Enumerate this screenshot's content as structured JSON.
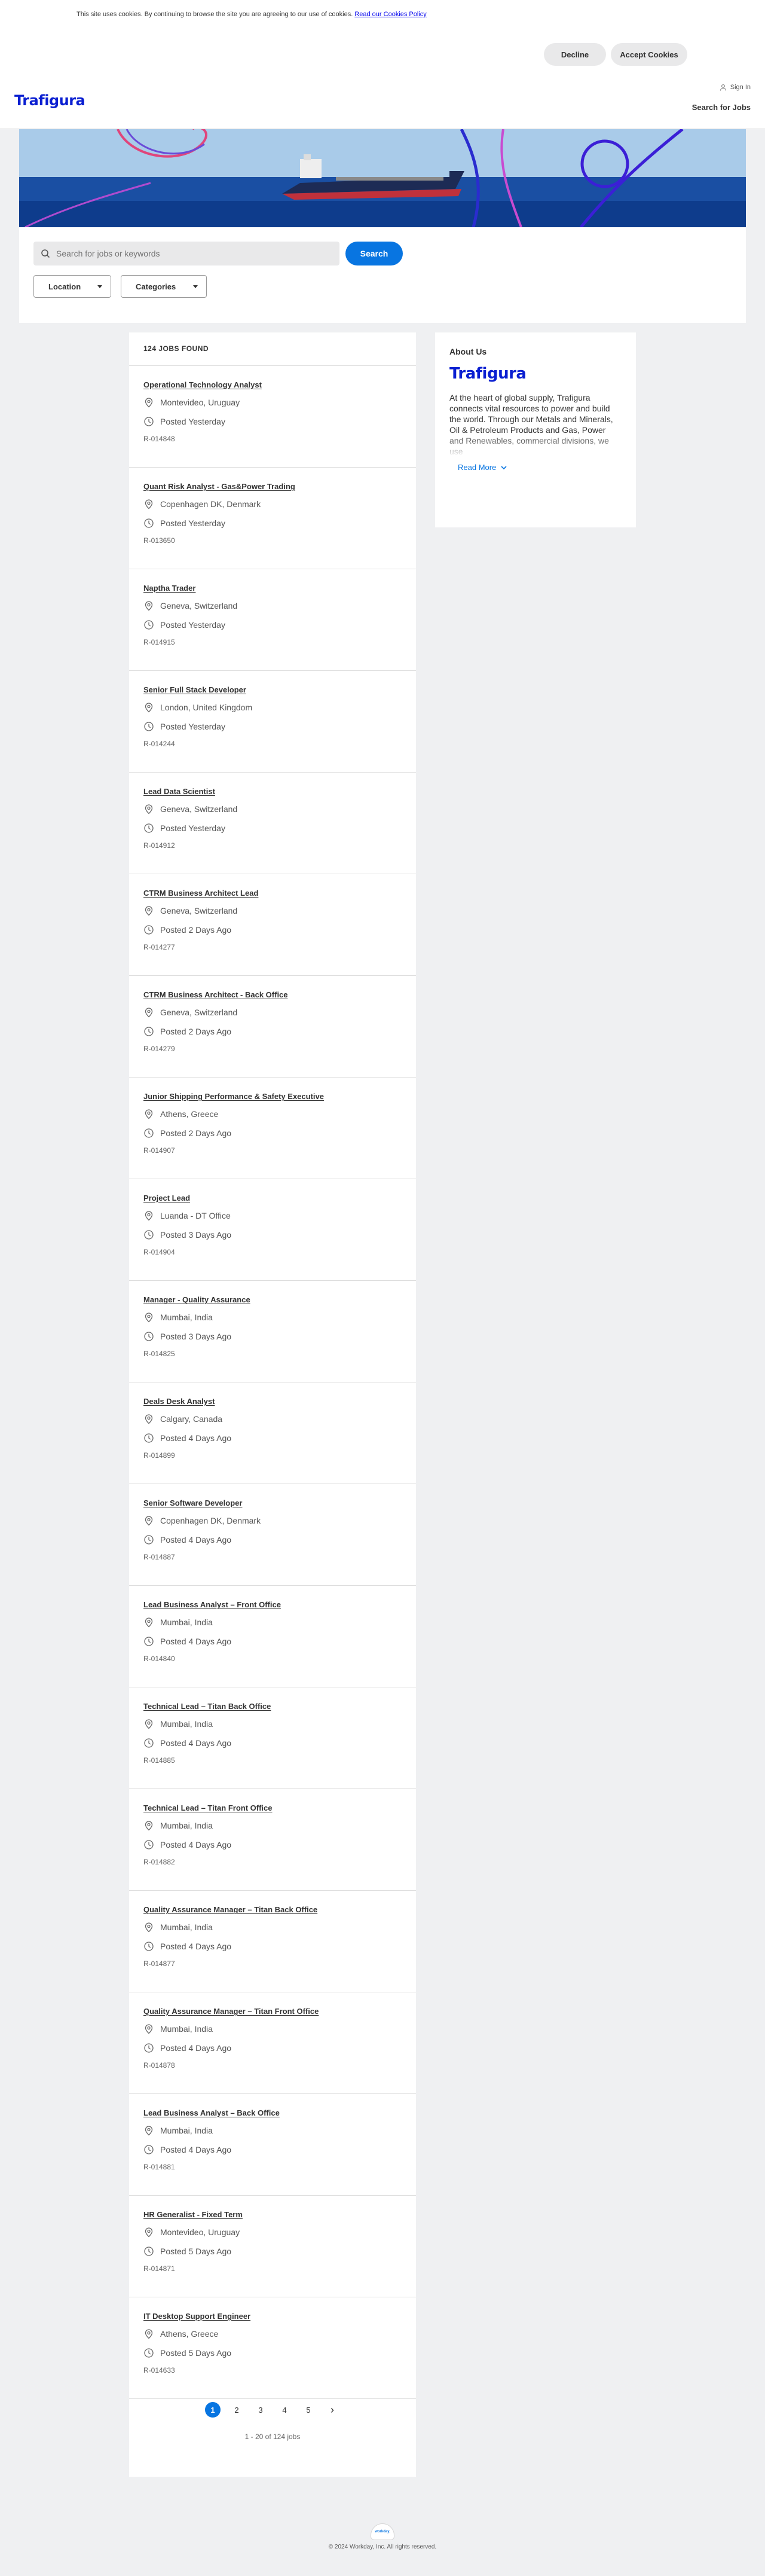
{
  "cookie": {
    "text": "This site uses cookies. By continuing to browse the site you are agreeing to our use of cookies.",
    "link": "Read our Cookies Policy",
    "decline": "Decline",
    "accept": "Accept Cookies"
  },
  "header": {
    "logo": "Trafigura",
    "signin": "Sign In",
    "search_jobs": "Search for Jobs"
  },
  "search": {
    "placeholder": "Search for jobs or keywords",
    "button": "Search",
    "location": "Location",
    "categories": "Categories"
  },
  "jobs": {
    "count": "124 JOBS FOUND",
    "items": [
      {
        "title": "Operational Technology Analyst",
        "location": "Montevideo, Uruguay",
        "posted": "Posted Yesterday",
        "id": "R-014848"
      },
      {
        "title": "Quant Risk Analyst - Gas&Power Trading",
        "location": "Copenhagen DK, Denmark",
        "posted": "Posted Yesterday",
        "id": "R-013650"
      },
      {
        "title": "Naptha Trader",
        "location": "Geneva, Switzerland",
        "posted": "Posted Yesterday",
        "id": "R-014915"
      },
      {
        "title": "Senior Full Stack Developer",
        "location": "London, United Kingdom",
        "posted": "Posted Yesterday",
        "id": "R-014244"
      },
      {
        "title": "Lead Data Scientist",
        "location": "Geneva, Switzerland",
        "posted": "Posted Yesterday",
        "id": "R-014912"
      },
      {
        "title": "CTRM Business Architect Lead",
        "location": "Geneva, Switzerland",
        "posted": "Posted 2 Days Ago",
        "id": "R-014277"
      },
      {
        "title": "CTRM Business Architect - Back Office",
        "location": "Geneva, Switzerland",
        "posted": "Posted 2 Days Ago",
        "id": "R-014279"
      },
      {
        "title": "Junior Shipping Performance & Safety Executive",
        "location": "Athens, Greece",
        "posted": "Posted 2 Days Ago",
        "id": "R-014907"
      },
      {
        "title": "Project Lead",
        "location": "Luanda - DT Office",
        "posted": "Posted 3 Days Ago",
        "id": "R-014904"
      },
      {
        "title": "Manager - Quality Assurance",
        "location": "Mumbai, India",
        "posted": "Posted 3 Days Ago",
        "id": "R-014825"
      },
      {
        "title": "Deals Desk Analyst",
        "location": "Calgary, Canada",
        "posted": "Posted 4 Days Ago",
        "id": "R-014899"
      },
      {
        "title": "Senior Software Developer",
        "location": "Copenhagen DK, Denmark",
        "posted": "Posted 4 Days Ago",
        "id": "R-014887"
      },
      {
        "title": "Lead Business Analyst – Front Office",
        "location": "Mumbai, India",
        "posted": "Posted 4 Days Ago",
        "id": "R-014840"
      },
      {
        "title": "Technical Lead – Titan Back Office",
        "location": "Mumbai, India",
        "posted": "Posted 4 Days Ago",
        "id": "R-014885"
      },
      {
        "title": "Technical Lead – Titan Front Office",
        "location": "Mumbai, India",
        "posted": "Posted 4 Days Ago",
        "id": "R-014882"
      },
      {
        "title": "Quality Assurance Manager – Titan Back Office",
        "location": "Mumbai, India",
        "posted": "Posted 4 Days Ago",
        "id": "R-014877"
      },
      {
        "title": "Quality Assurance Manager – Titan Front Office",
        "location": "Mumbai, India",
        "posted": "Posted 4 Days Ago",
        "id": "R-014878"
      },
      {
        "title": "Lead Business Analyst – Back Office",
        "location": "Mumbai, India",
        "posted": "Posted 4 Days Ago",
        "id": "R-014881"
      },
      {
        "title": "HR Generalist - Fixed Term",
        "location": "Montevideo, Uruguay",
        "posted": "Posted 5 Days Ago",
        "id": "R-014871"
      },
      {
        "title": "IT Desktop Support Engineer",
        "location": "Athens, Greece",
        "posted": "Posted 5 Days Ago",
        "id": "R-014633"
      }
    ]
  },
  "pagination": {
    "pages": [
      "1",
      "2",
      "3",
      "4",
      "5"
    ],
    "next": "›",
    "range": "1 - 20 of 124 jobs"
  },
  "about": {
    "heading": "About Us",
    "logo": "Trafigura",
    "text": "At the heart of global supply, Trafigura connects vital resources to power and build the world. Through our Metals and Minerals, Oil & Petroleum Products and Gas, Power and Renewables, commercial divisions, we use",
    "read_more": "Read More"
  },
  "footer": {
    "badge": "workday.",
    "copyright": "© 2024 Workday, Inc. All rights reserved."
  },
  "colors": {
    "brand": "#0a1fd1",
    "accent": "#0875e1",
    "background": "#eff0f2"
  }
}
